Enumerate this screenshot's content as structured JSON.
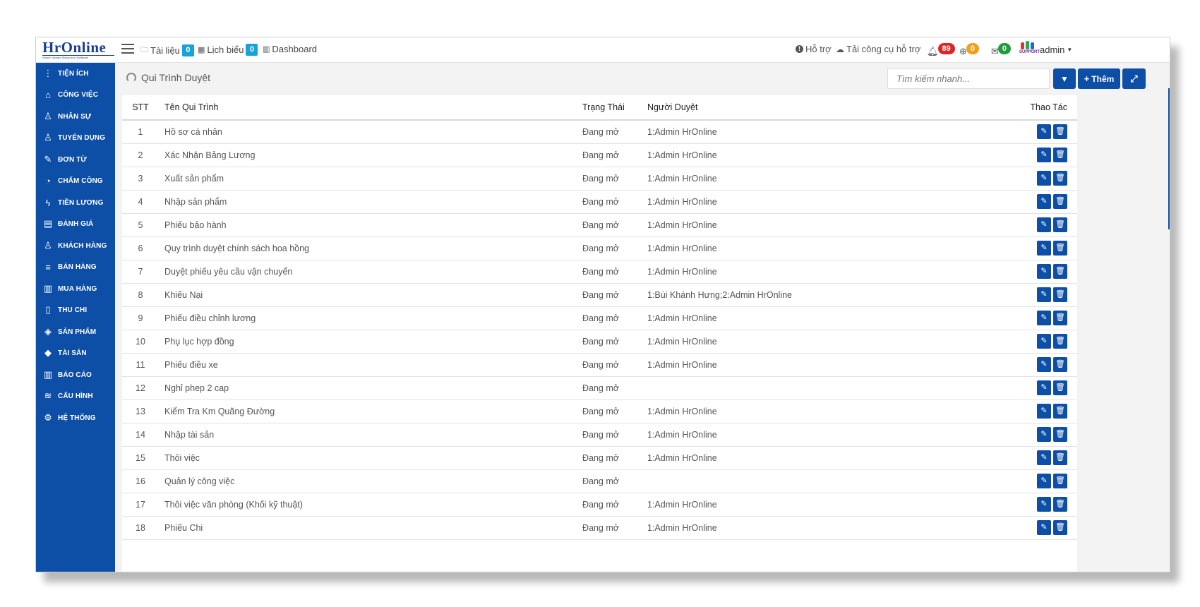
{
  "brand": {
    "name": "HrOnline",
    "tagline": "Smart Human Resource Software"
  },
  "topnav": [
    {
      "icon": "folder-icon",
      "label": "Tài liệu",
      "badge": "0"
    },
    {
      "icon": "calendar-icon",
      "label": "Lịch biểu",
      "badge": "0"
    },
    {
      "icon": "bar-chart-icon",
      "label": "Dashboard"
    }
  ],
  "topright": {
    "support": "Hỗ trợ",
    "download_tool": "Tải công cụ hỗ trợ",
    "notif_count": "89",
    "globe_count": "0",
    "mail_count": "0",
    "user": "admin",
    "support_logo_text": "SUPPORT"
  },
  "colors": {
    "primary": "#0d4ea6",
    "badge_red": "#e02424",
    "badge_orange": "#f0a020",
    "badge_green": "#1f9d3a",
    "badge_blue": "#17a2d8"
  },
  "sidebar": [
    {
      "icon": "more-vertical-icon",
      "label": "Tiện ích"
    },
    {
      "icon": "inbox-icon",
      "label": "Công việc"
    },
    {
      "icon": "user-icon",
      "label": "Nhân sự"
    },
    {
      "icon": "user-plus-icon",
      "label": "Tuyển dụng"
    },
    {
      "icon": "edit-icon",
      "label": "Đơn từ"
    },
    {
      "icon": "gauge-icon",
      "label": "Chấm công"
    },
    {
      "icon": "lightning-icon",
      "label": "Tiền lương"
    },
    {
      "icon": "book-icon",
      "label": "Đánh giá"
    },
    {
      "icon": "user-icon",
      "label": "Khách hàng"
    },
    {
      "icon": "list-icon",
      "label": "Bán hàng"
    },
    {
      "icon": "map-icon",
      "label": "Mua hàng"
    },
    {
      "icon": "file-icon",
      "label": "Thu chi"
    },
    {
      "icon": "tag-icon",
      "label": "Sản phẩm"
    },
    {
      "icon": "diamond-icon",
      "label": "Tài sản"
    },
    {
      "icon": "bar-chart-icon",
      "label": "Báo cáo"
    },
    {
      "icon": "layers-icon",
      "label": "Cấu hình"
    },
    {
      "icon": "settings-icon",
      "label": "Hệ thống"
    }
  ],
  "page": {
    "title": "Qui Trình Duyệt",
    "search_placeholder": "Tìm kiếm nhanh...",
    "add_label": "Thêm"
  },
  "table": {
    "columns": {
      "stt": "STT",
      "name": "Tên Qui Trình",
      "status": "Trạng Thái",
      "approvers": "Người Duyệt",
      "actions": "Thao Tác"
    },
    "rows": [
      {
        "stt": "1",
        "name": "Hồ sơ cá nhân",
        "status": "Đang mở",
        "approvers": "1:Admin HrOnline"
      },
      {
        "stt": "2",
        "name": "Xác Nhận Bảng Lương",
        "status": "Đang mở",
        "approvers": "1:Admin HrOnline"
      },
      {
        "stt": "3",
        "name": "Xuất sản phẩm",
        "status": "Đang mở",
        "approvers": "1:Admin HrOnline"
      },
      {
        "stt": "4",
        "name": "Nhập sản phẩm",
        "status": "Đang mở",
        "approvers": "1:Admin HrOnline"
      },
      {
        "stt": "5",
        "name": "Phiếu bảo hành",
        "status": "Đang mở",
        "approvers": "1:Admin HrOnline"
      },
      {
        "stt": "6",
        "name": "Quy trình duyệt chính sách hoa hồng",
        "status": "Đang mở",
        "approvers": "1:Admin HrOnline"
      },
      {
        "stt": "7",
        "name": "Duyệt phiếu yêu cầu vận chuyển",
        "status": "Đang mở",
        "approvers": "1:Admin HrOnline"
      },
      {
        "stt": "8",
        "name": "Khiếu Nại",
        "status": "Đang mở",
        "approvers": "1:Bùi Khánh Hưng;2:Admin HrOnline"
      },
      {
        "stt": "9",
        "name": "Phiếu điều chỉnh lương",
        "status": "Đang mở",
        "approvers": "1:Admin HrOnline"
      },
      {
        "stt": "10",
        "name": "Phụ lục hợp đồng",
        "status": "Đang mở",
        "approvers": "1:Admin HrOnline"
      },
      {
        "stt": "11",
        "name": "Phiếu điều xe",
        "status": "Đang mở",
        "approvers": "1:Admin HrOnline"
      },
      {
        "stt": "12",
        "name": "Nghỉ phep 2 cap",
        "status": "Đang mở",
        "approvers": ""
      },
      {
        "stt": "13",
        "name": "Kiểm Tra Km Quãng Đường",
        "status": "Đang mở",
        "approvers": "1:Admin HrOnline"
      },
      {
        "stt": "14",
        "name": "Nhập tài sản",
        "status": "Đang mở",
        "approvers": "1:Admin HrOnline"
      },
      {
        "stt": "15",
        "name": "Thôi việc",
        "status": "Đang mở",
        "approvers": "1:Admin HrOnline"
      },
      {
        "stt": "16",
        "name": "Quản lý công việc",
        "status": "Đang mở",
        "approvers": ""
      },
      {
        "stt": "17",
        "name": "Thôi việc văn phòng (Khối kỹ thuật)",
        "status": "Đang mở",
        "approvers": "1:Admin HrOnline"
      },
      {
        "stt": "18",
        "name": "Phiếu Chi",
        "status": "Đang mở",
        "approvers": "1:Admin HrOnline"
      }
    ]
  }
}
